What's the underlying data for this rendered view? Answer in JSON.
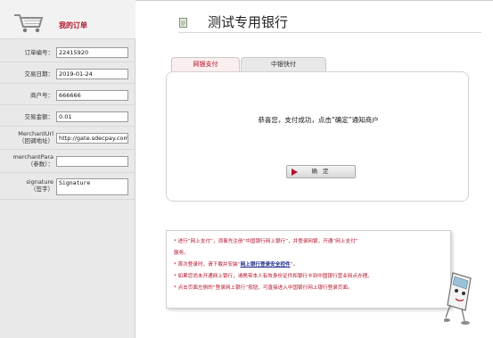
{
  "sidebar": {
    "title": "我的订单",
    "fields": [
      {
        "label": "订单编号：",
        "value": "22415920"
      },
      {
        "label": "交易日期：",
        "value": "2019-01-24"
      },
      {
        "label": "商户号：",
        "value": "666666"
      },
      {
        "label": "交易金额：",
        "value": "0.01"
      },
      {
        "label": "MerchantUrl",
        "label2": "（回调地址）",
        "value": "http://gate.sdecpay.com"
      },
      {
        "label": "merchantPara",
        "label2": "（参数）：",
        "value": ""
      },
      {
        "label": "signature",
        "label2": "（签字）",
        "value": "Signature"
      }
    ]
  },
  "bank": {
    "title": "测试专用银行"
  },
  "tabs": [
    {
      "label": "网银支付",
      "active": true
    },
    {
      "label": "中银快付",
      "active": false
    }
  ],
  "panel": {
    "message": "恭喜您，支付成功，点击“确定”通知商户",
    "confirm_label": "确 定"
  },
  "notice": {
    "line1": "进行“网上支付”，须事先注册“中国银行网上银行”，并登录网银，开通“网上支付”",
    "line1b": "服务。",
    "line2_pre": "首次登录时，请下载并安装“",
    "line2_link": "网上银行登录安全控件",
    "line2_post": "”。",
    "line3": "如果您尚未开通网上银行，请携带本人有效身份证件和银行卡到中国银行营业网点办理。",
    "line4": "点击页面左侧的“登录网上银行”按钮，可直接进入中国银行网上银行登录页面。"
  },
  "colors": {
    "accent": "#b3132a",
    "sidebar_bg": "#e9e9e9",
    "link": "#1d2a8a"
  },
  "icons": {
    "cart": "shopping-cart-icon",
    "bank": "document-icon",
    "mascot": "card-mascot-icon"
  }
}
